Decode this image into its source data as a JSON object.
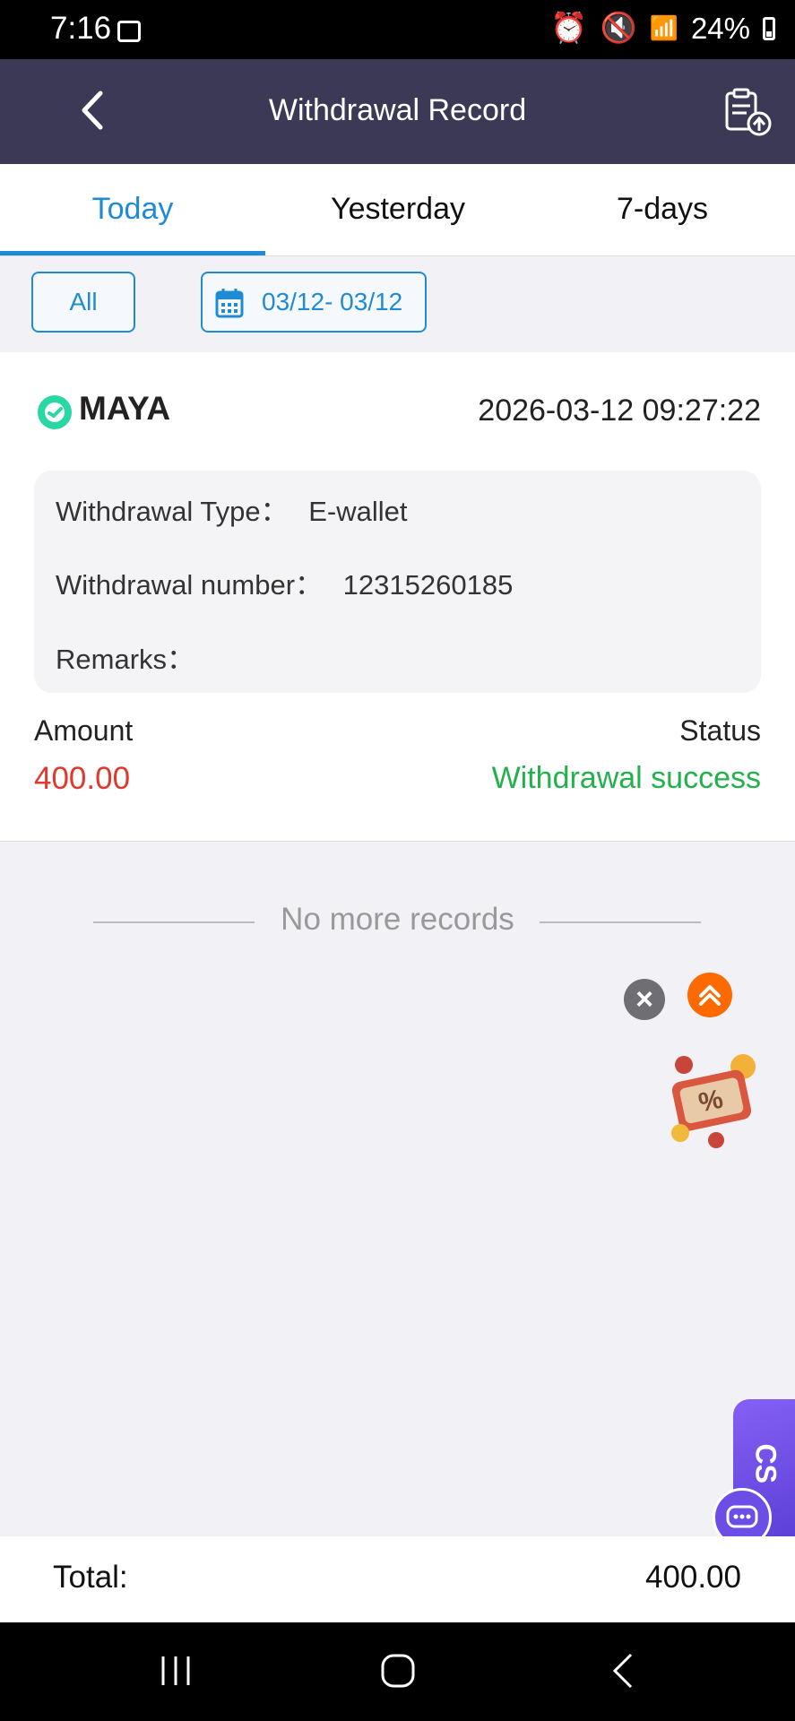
{
  "status_bar": {
    "time": "7:16",
    "battery": "24%"
  },
  "header": {
    "title": "Withdrawal Record"
  },
  "tabs": [
    {
      "label": "Today",
      "active": true
    },
    {
      "label": "Yesterday",
      "active": false
    },
    {
      "label": "7-days",
      "active": false
    }
  ],
  "filters": {
    "all_label": "All",
    "date_range": "03/12- 03/12"
  },
  "record": {
    "provider": "MAYA",
    "datetime": "2026-03-12 09:27:22",
    "type_label": "Withdrawal Type：",
    "type_value": "E-wallet",
    "number_label": "Withdrawal number：",
    "number_value": "12315260185",
    "remarks_label": "Remarks：",
    "remarks_value": "",
    "amount_label": "Amount",
    "amount_value": "400.00",
    "status_label": "Status",
    "status_value": "Withdrawal success"
  },
  "list_end_text": "No more records",
  "floating": {
    "cs_label": "CS"
  },
  "total": {
    "label": "Total:",
    "value": "400.00"
  },
  "colors": {
    "header_bg": "#3b3955",
    "accent_blue": "#1f8ad6",
    "amount_red": "#e0392b",
    "success_green": "#22b14c"
  }
}
